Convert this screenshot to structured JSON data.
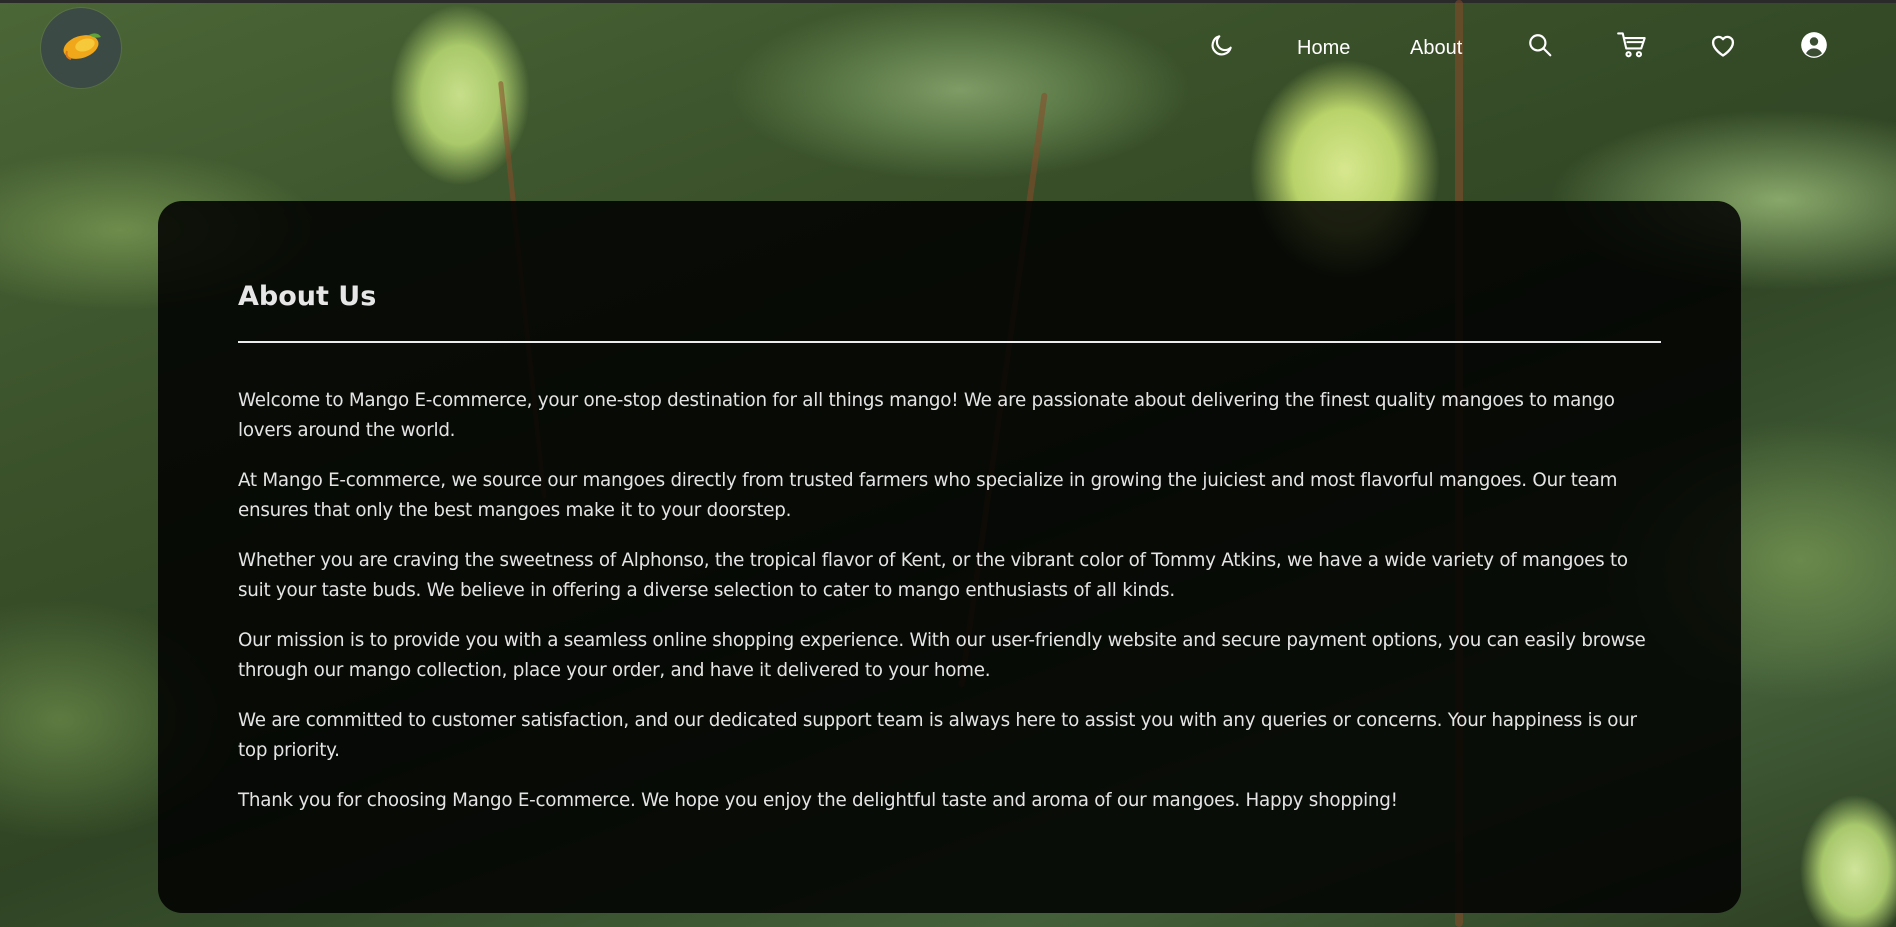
{
  "header": {
    "logo_icon": "mango-logo-icon",
    "nav": {
      "theme_toggle_icon": "moon-icon",
      "home_label": "Home",
      "about_label": "About",
      "search_icon": "search-icon",
      "cart_icon": "cart-icon",
      "wishlist_icon": "heart-icon",
      "account_icon": "user-icon"
    }
  },
  "about": {
    "title": "About Us",
    "paragraphs": [
      "Welcome to Mango E-commerce, your one-stop destination for all things mango! We are passionate about delivering the finest quality mangoes to mango lovers around the world.",
      "At Mango E-commerce, we source our mangoes directly from trusted farmers who specialize in growing the juiciest and most flavorful mangoes. Our team ensures that only the best mangoes make it to your doorstep.",
      "Whether you are craving the sweetness of Alphonso, the tropical flavor of Kent, or the vibrant color of Tommy Atkins, we have a wide variety of mangoes to suit your taste buds. We believe in offering a diverse selection to cater to mango enthusiasts of all kinds.",
      "Our mission is to provide you with a seamless online shopping experience. With our user-friendly website and secure payment options, you can easily browse through our mango collection, place your order, and have it delivered to your home.",
      "We are committed to customer satisfaction, and our dedicated support team is always here to assist you with any queries or concerns. Your happiness is our top priority.",
      "Thank you for choosing Mango E-commerce. We hope you enjoy the delightful taste and aroma of our mangoes. Happy shopping!"
    ]
  },
  "colors": {
    "panel_bg": "#000000",
    "text": "#e4e4e4",
    "nav_text": "#ffffff"
  }
}
